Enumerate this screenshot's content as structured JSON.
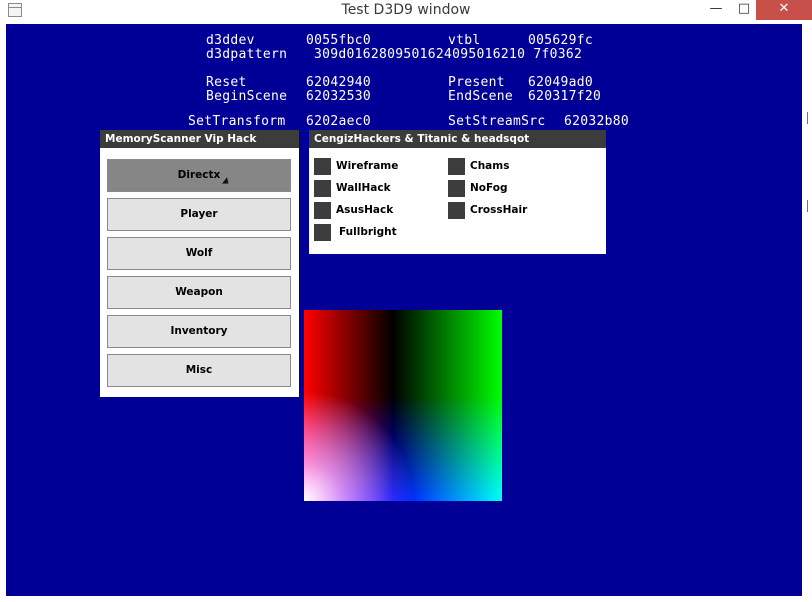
{
  "window": {
    "title": "Test D3D9 window",
    "controls": {
      "minimize": "—",
      "maximize": "□",
      "close": "✕"
    }
  },
  "colors": {
    "background": "#000096",
    "panel_header": "#3c3c3c",
    "active_button": "#868686",
    "close_button": "#c7514a"
  },
  "debug": {
    "d3ddev_label": "d3ddev",
    "d3ddev_value": "0055fbc0",
    "vtbl_label": "vtbl",
    "vtbl_value": "005629fc",
    "pattern_label": "d3dpattern",
    "pattern_value": "309d0162809501624095016210 7f0362",
    "reset_label": "Reset",
    "reset_value": "62042940",
    "present_label": "Present",
    "present_value": "62049ad0",
    "beginscene_label": "BeginScene",
    "beginscene_value": "62032530",
    "endscene_label": "EndScene",
    "endscene_value": "620317f20",
    "settransform_label": "SetTransform",
    "settransform_value": "6202aec0",
    "setstreamsrc_label": "SetStreamSrc",
    "setstreamsrc_value": "62032b80"
  },
  "menu_panel": {
    "title": "MemoryScanner Vip Hack",
    "items": [
      "Directx",
      "Player",
      "Wolf",
      "Weapon",
      "Inventory",
      "Misc"
    ],
    "active": "Directx"
  },
  "options_panel": {
    "title": "CengizHackers & Titanic & headsqot",
    "left_options": [
      "Wireframe",
      "WallHack",
      "AsusHack",
      "Fullbright"
    ],
    "right_options": [
      "Chams",
      "NoFog",
      "CrossHair"
    ]
  }
}
